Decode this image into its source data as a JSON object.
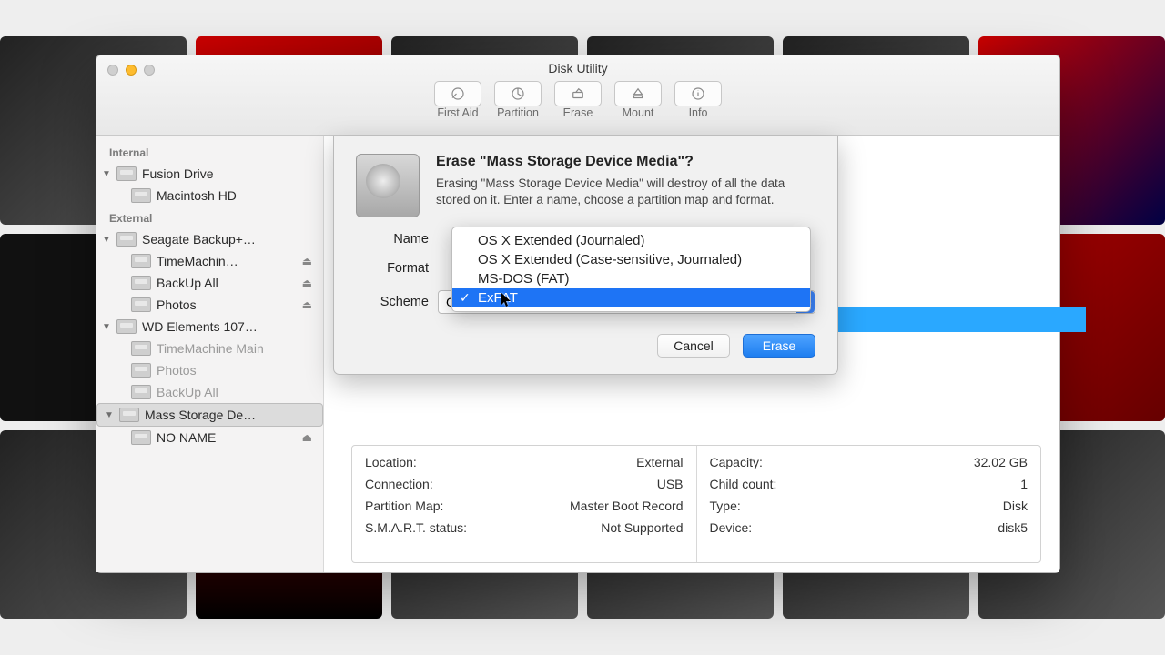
{
  "window": {
    "title": "Disk Utility"
  },
  "toolbar": [
    {
      "id": "first-aid",
      "label": "First Aid"
    },
    {
      "id": "partition",
      "label": "Partition"
    },
    {
      "id": "erase",
      "label": "Erase"
    },
    {
      "id": "mount",
      "label": "Mount"
    },
    {
      "id": "info",
      "label": "Info"
    }
  ],
  "sidebar": {
    "sections": [
      {
        "header": "Internal",
        "items": [
          {
            "label": "Fusion Drive",
            "level": 0,
            "expanded": true
          },
          {
            "label": "Macintosh HD",
            "level": 1
          }
        ]
      },
      {
        "header": "External",
        "items": [
          {
            "label": "Seagate Backup+…",
            "level": 0,
            "expanded": true
          },
          {
            "label": "TimeMachin…",
            "level": 1,
            "eject": true
          },
          {
            "label": "BackUp All",
            "level": 1,
            "eject": true
          },
          {
            "label": "Photos",
            "level": 1,
            "eject": true
          },
          {
            "label": "WD Elements 107…",
            "level": 0,
            "expanded": true
          },
          {
            "label": "TimeMachine Main",
            "level": 1,
            "dim": true
          },
          {
            "label": "Photos",
            "level": 1,
            "dim": true
          },
          {
            "label": "BackUp All",
            "level": 1,
            "dim": true
          },
          {
            "label": "Mass Storage De…",
            "level": 0,
            "expanded": true,
            "selected": true
          },
          {
            "label": "NO NAME",
            "level": 1,
            "eject": true
          }
        ]
      }
    ]
  },
  "sheet": {
    "title": "Erase \"Mass Storage Device Media\"?",
    "desc": "Erasing \"Mass Storage Device Media\" will destroy of all the data stored on it. Enter a name, choose a partition map and format.",
    "name_label": "Name",
    "format_label": "Format",
    "scheme_label": "Scheme",
    "scheme_value": "GUID Partition Map",
    "cancel": "Cancel",
    "erase": "Erase"
  },
  "format_dropdown": {
    "options": [
      "OS X Extended (Journaled)",
      "OS X Extended (Case-sensitive, Journaled)",
      "MS-DOS (FAT)",
      "ExFAT"
    ],
    "selected": "ExFAT"
  },
  "details": {
    "left": [
      {
        "k": "Location:",
        "v": "External"
      },
      {
        "k": "Connection:",
        "v": "USB"
      },
      {
        "k": "Partition Map:",
        "v": "Master Boot Record"
      },
      {
        "k": "S.M.A.R.T. status:",
        "v": "Not Supported"
      }
    ],
    "right": [
      {
        "k": "Capacity:",
        "v": "32.02 GB"
      },
      {
        "k": "Child count:",
        "v": "1"
      },
      {
        "k": "Type:",
        "v": "Disk"
      },
      {
        "k": "Device:",
        "v": "disk5"
      }
    ]
  }
}
